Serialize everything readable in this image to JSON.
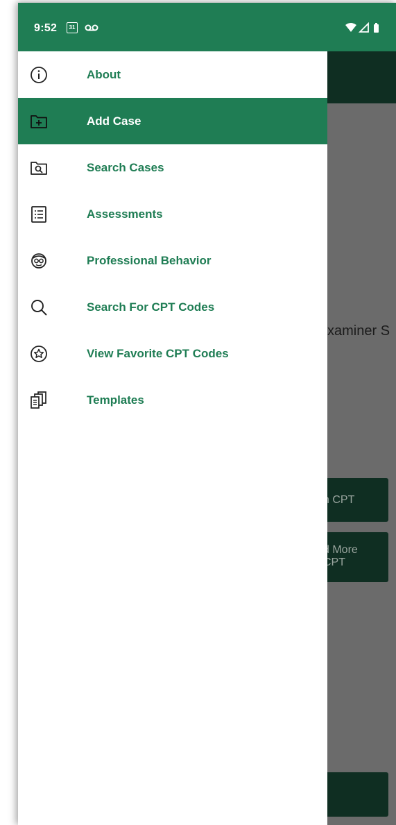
{
  "status_bar": {
    "time": "9:52",
    "calendar_day": "31",
    "bg_color": "#1f7d54"
  },
  "background_app": {
    "partial_text": "xaminer S",
    "button1_label": "h CPT",
    "button2_line1": "d More",
    "button2_line2": "CPT"
  },
  "drawer": {
    "accent_color": "#1f7d54",
    "items": [
      {
        "label": "About",
        "icon": "info-icon",
        "selected": false
      },
      {
        "label": "Add Case",
        "icon": "folder-add-icon",
        "selected": true
      },
      {
        "label": "Search Cases",
        "icon": "folder-search-icon",
        "selected": false
      },
      {
        "label": "Assessments",
        "icon": "list-document-icon",
        "selected": false
      },
      {
        "label": "Professional Behavior",
        "icon": "person-glasses-icon",
        "selected": false
      },
      {
        "label": "Search For CPT Codes",
        "icon": "search-icon",
        "selected": false
      },
      {
        "label": "View Favorite CPT Codes",
        "icon": "star-circle-icon",
        "selected": false
      },
      {
        "label": "Templates",
        "icon": "templates-icon",
        "selected": false
      }
    ]
  }
}
